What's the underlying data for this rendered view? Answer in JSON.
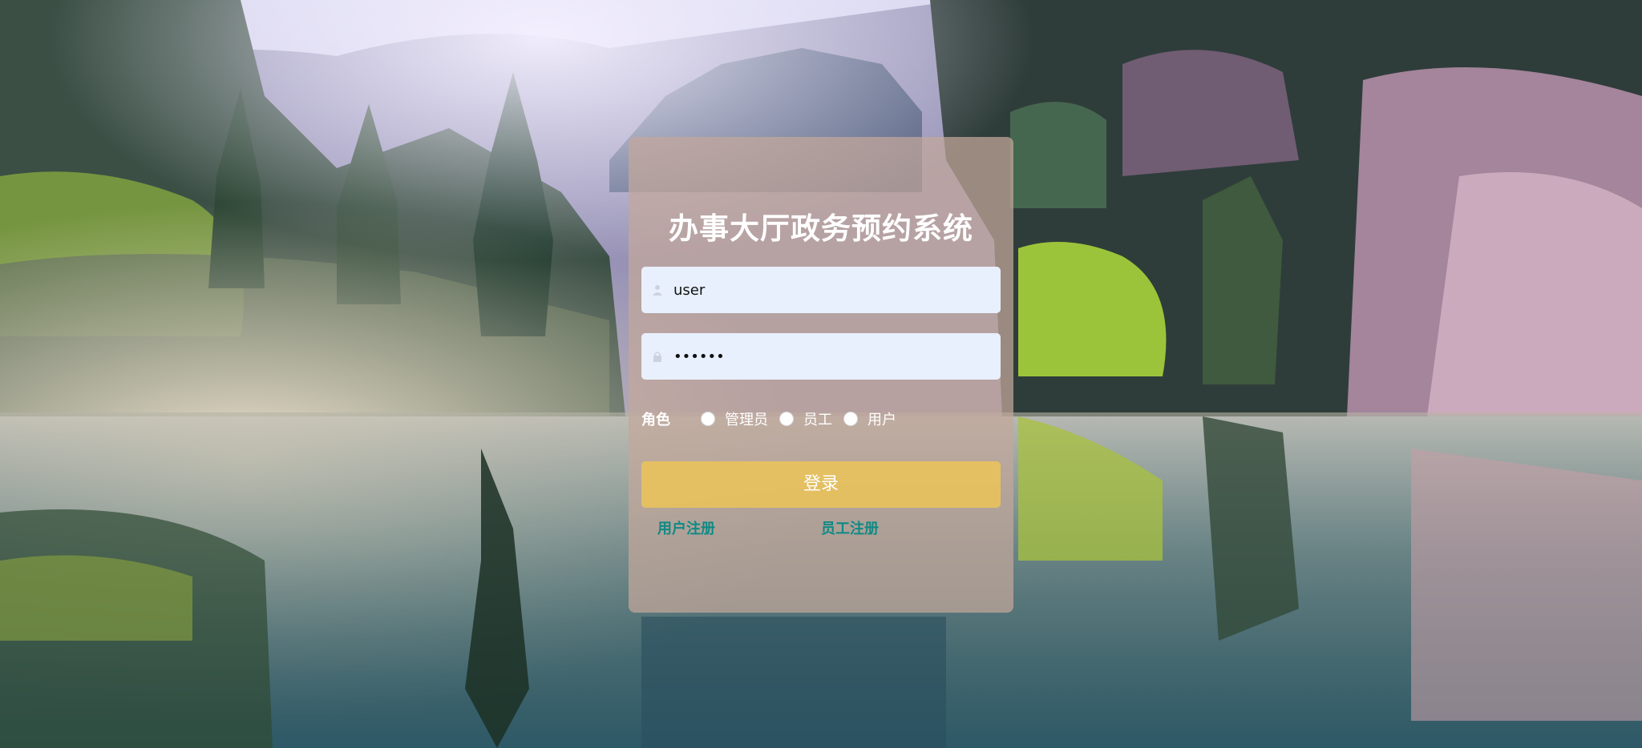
{
  "page": {
    "title": "办事大厅政务预约系统"
  },
  "form": {
    "username": {
      "value": "user",
      "icon": "user-icon"
    },
    "password": {
      "value": "••••••",
      "icon": "lock-icon"
    },
    "role": {
      "label": "角色",
      "options": [
        "管理员",
        "员工",
        "用户"
      ],
      "selected": null
    },
    "login_button": "登录",
    "links": {
      "user_register": "用户注册",
      "staff_register": "员工注册"
    }
  },
  "colors": {
    "card_background": "#c4a89b",
    "input_background": "#e8f0fe",
    "button_background": "#ecc458",
    "link_color": "#0e8a84",
    "text_light": "#ffffff"
  },
  "background": {
    "scene": "misty-lake-forest-landscape"
  }
}
